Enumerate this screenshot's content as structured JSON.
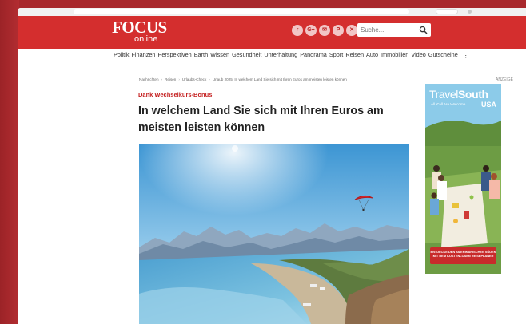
{
  "header": {
    "logo_main": "FOCUS",
    "logo_sub": "online",
    "social_icons": [
      "reddit-icon",
      "google-icon",
      "mail-icon",
      "pinterest-icon",
      "x-icon"
    ],
    "social_glyphs": [
      "r",
      "G+",
      "✉",
      "P",
      "✕"
    ],
    "search_placeholder": "Suche...",
    "brand_color": "#d42e2e"
  },
  "nav": {
    "items": [
      "Politik",
      "Finanzen",
      "Perspektiven",
      "Earth",
      "Wissen",
      "Gesundheit",
      "Unterhaltung",
      "Panorama",
      "Sport",
      "Reisen",
      "Auto",
      "Immobilien",
      "Video",
      "Gutscheine"
    ],
    "more_label": "⋮"
  },
  "breadcrumb": {
    "items": [
      "Nachrichten",
      "Reisen",
      "Urlaubs-Check",
      "Urlaub 2025: In welchem Land Sie sich mit Ihren Euros am meisten leisten können"
    ]
  },
  "article": {
    "kicker": "Dank Wechselkurs-Bonus",
    "headline": "In welchem Land Sie sich mit Ihren Euros am meisten leisten können"
  },
  "ad": {
    "label": "ANZEIGE",
    "title_light": "Travel",
    "title_bold": "South",
    "title_country": "USA",
    "subtitle": "All Y'all Are Welcome",
    "cta": "ENTDECKE DEN AMERIKANISCHEN SÜDEN MIT DEM KOSTENLOSEN REISEPLANER"
  }
}
